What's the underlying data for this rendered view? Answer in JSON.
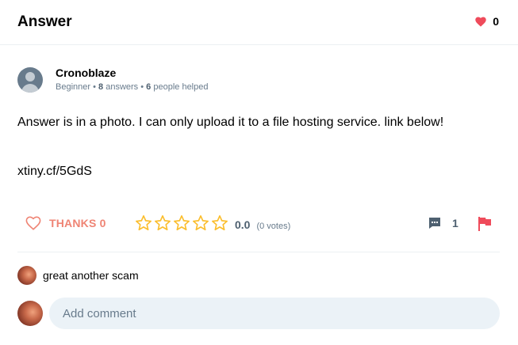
{
  "header": {
    "title": "Answer",
    "likes_count": "0"
  },
  "author": {
    "name": "Cronoblaze",
    "rank": "Beginner",
    "answers_count": "8",
    "answers_label": "answers",
    "helped_count": "6",
    "helped_label": "people helped"
  },
  "answer": {
    "text": "Answer is in a photo. I can only upload it to a file hosting service. link below!",
    "link": "xtiny.cf/5GdS"
  },
  "actions": {
    "thanks_label": "THANKS 0",
    "rating_value": "0.0",
    "rating_votes": "(0 votes)",
    "rating_stars_filled": 0,
    "rating_stars_total": 5,
    "comments_count": "1"
  },
  "comments": [
    {
      "text": "great another scam"
    }
  ],
  "add_comment": {
    "placeholder": "Add comment"
  },
  "colors": {
    "heart": "#ef4b5b",
    "thanks": "#ef8474",
    "star": "#fbbe2e",
    "flag": "#ef4b5b",
    "meta": "#687b8c"
  }
}
